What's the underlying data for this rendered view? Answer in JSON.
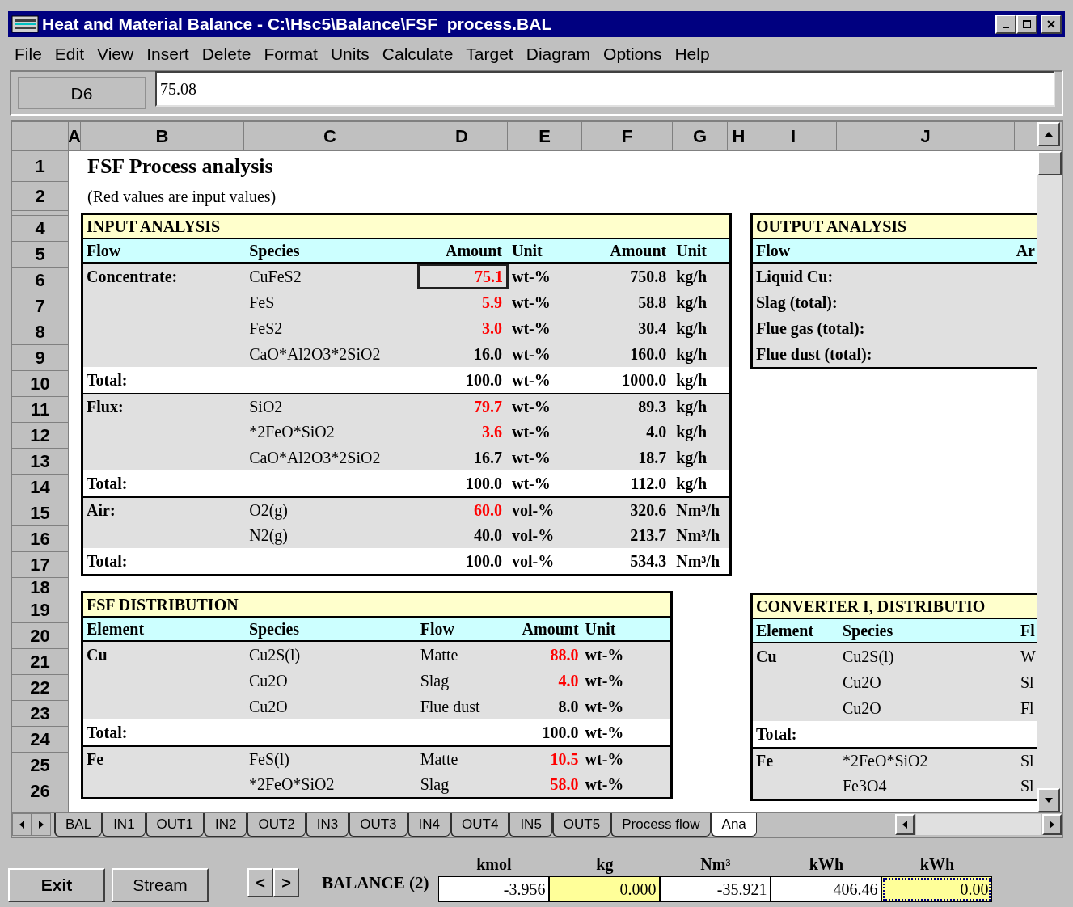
{
  "window": {
    "title": "Heat and Material Balance - C:\\Hsc5\\Balance\\FSF_process.BAL"
  },
  "menu": [
    "File",
    "Edit",
    "View",
    "Insert",
    "Delete",
    "Format",
    "Units",
    "Calculate",
    "Target",
    "Diagram",
    "Options",
    "Help"
  ],
  "formula_bar": {
    "cell": "D6",
    "value": "75.08"
  },
  "columns": [
    "A",
    "B",
    "C",
    "D",
    "E",
    "F",
    "G",
    "H",
    "I",
    "J"
  ],
  "row_numbers": [
    "1",
    "2",
    "4",
    "5",
    "6",
    "7",
    "8",
    "9",
    "10",
    "11",
    "12",
    "13",
    "14",
    "15",
    "16",
    "17",
    "18",
    "19",
    "20",
    "21",
    "22",
    "23",
    "24",
    "25",
    "26"
  ],
  "sheet_title": "FSF Process analysis",
  "sheet_note": "(Red values are input values)",
  "input_analysis": {
    "title": "INPUT ANALYSIS",
    "header": [
      "Flow",
      "Species",
      "Amount",
      "Unit",
      "Amount",
      "Unit"
    ],
    "rows": [
      {
        "flow": "Concentrate:",
        "species": "CuFeS2",
        "amount": "75.1",
        "unit": "wt-%",
        "amount2": "750.8",
        "unit2": "kg/h",
        "input": true,
        "total": false,
        "selected": true
      },
      {
        "species": "FeS",
        "amount": "5.9",
        "unit": "wt-%",
        "amount2": "58.8",
        "unit2": "kg/h",
        "input": true,
        "total": false,
        "selected": false
      },
      {
        "species": "FeS2",
        "amount": "3.0",
        "unit": "wt-%",
        "amount2": "30.4",
        "unit2": "kg/h",
        "input": true,
        "total": false,
        "selected": false
      },
      {
        "species": "CaO*Al2O3*2SiO2",
        "amount": "16.0",
        "unit": "wt-%",
        "amount2": "160.0",
        "unit2": "kg/h",
        "input": false,
        "total": false,
        "selected": false
      },
      {
        "flow": "Total:",
        "amount": "100.0",
        "unit": "wt-%",
        "amount2": "1000.0",
        "unit2": "kg/h",
        "input": false,
        "total": true,
        "selected": false
      },
      {
        "flow": "Flux:",
        "species": "SiO2",
        "amount": "79.7",
        "unit": "wt-%",
        "amount2": "89.3",
        "unit2": "kg/h",
        "input": true,
        "total": false,
        "selected": false
      },
      {
        "species": "*2FeO*SiO2",
        "amount": "3.6",
        "unit": "wt-%",
        "amount2": "4.0",
        "unit2": "kg/h",
        "input": true,
        "total": false,
        "selected": false
      },
      {
        "species": "CaO*Al2O3*2SiO2",
        "amount": "16.7",
        "unit": "wt-%",
        "amount2": "18.7",
        "unit2": "kg/h",
        "input": false,
        "total": false,
        "selected": false
      },
      {
        "flow": "Total:",
        "amount": "100.0",
        "unit": "wt-%",
        "amount2": "112.0",
        "unit2": "kg/h",
        "input": false,
        "total": true,
        "selected": false
      },
      {
        "flow": "Air:",
        "species": "O2(g)",
        "amount": "60.0",
        "unit": "vol-%",
        "amount2": "320.6",
        "unit2": "Nm³/h",
        "input": true,
        "total": false,
        "selected": false
      },
      {
        "species": "N2(g)",
        "amount": "40.0",
        "unit": "vol-%",
        "amount2": "213.7",
        "unit2": "Nm³/h",
        "input": false,
        "total": false,
        "selected": false
      },
      {
        "flow": "Total:",
        "amount": "100.0",
        "unit": "vol-%",
        "amount2": "534.3",
        "unit2": "Nm³/h",
        "input": false,
        "total": true,
        "selected": false
      }
    ]
  },
  "output_analysis": {
    "title": "OUTPUT ANALYSIS",
    "header": [
      "Flow",
      "Ar"
    ],
    "rows": [
      "Liquid Cu:",
      "Slag (total):",
      "Flue gas (total):",
      "Flue dust (total):"
    ]
  },
  "fsf_distribution": {
    "title": "FSF DISTRIBUTION",
    "header": [
      "Element",
      "Species",
      "Flow",
      "Amount",
      "Unit"
    ],
    "rows": [
      {
        "element": "Cu",
        "species": "Cu2S(l)",
        "flow": "Matte",
        "amount": "88.0",
        "unit": "wt-%",
        "input": true,
        "total": false
      },
      {
        "species": "Cu2O",
        "flow": "Slag",
        "amount": "4.0",
        "unit": "wt-%",
        "input": true,
        "total": false
      },
      {
        "species": "Cu2O",
        "flow": "Flue dust",
        "amount": "8.0",
        "unit": "wt-%",
        "input": false,
        "total": false
      },
      {
        "element": "Total:",
        "amount": "100.0",
        "unit": "wt-%",
        "input": false,
        "total": true
      },
      {
        "element": "Fe",
        "species": "FeS(l)",
        "flow": "Matte",
        "amount": "10.5",
        "unit": "wt-%",
        "input": true,
        "total": false
      },
      {
        "species": "*2FeO*SiO2",
        "flow": "Slag",
        "amount": "58.0",
        "unit": "wt-%",
        "input": true,
        "total": false
      }
    ]
  },
  "converter_distribution": {
    "title": "CONVERTER I, DISTRIBUTIO",
    "header": [
      "Element",
      "Species",
      "Fl"
    ],
    "rows": [
      {
        "element": "Cu",
        "species": "Cu2S(l)",
        "flow": "W",
        "total": false
      },
      {
        "species": "Cu2O",
        "flow": "Sl",
        "total": false
      },
      {
        "species": "Cu2O",
        "flow": "Fl",
        "total": false
      },
      {
        "element": "Total:",
        "total": true
      },
      {
        "element": "Fe",
        "species": "*2FeO*SiO2",
        "flow": "Sl",
        "total": false
      },
      {
        "species": "Fe3O4",
        "flow": "Sl",
        "total": false
      }
    ]
  },
  "sheet_tabs": [
    {
      "label": "BAL",
      "selected": false
    },
    {
      "label": "IN1",
      "selected": false
    },
    {
      "label": "OUT1",
      "selected": false
    },
    {
      "label": "IN2",
      "selected": false
    },
    {
      "label": "OUT2",
      "selected": false
    },
    {
      "label": "IN3",
      "selected": false
    },
    {
      "label": "OUT3",
      "selected": false
    },
    {
      "label": "IN4",
      "selected": false
    },
    {
      "label": "OUT4",
      "selected": false
    },
    {
      "label": "IN5",
      "selected": false
    },
    {
      "label": "OUT5",
      "selected": false
    },
    {
      "label": "Process flow",
      "selected": false
    },
    {
      "label": "Ana",
      "selected": true
    }
  ],
  "buttons": [
    {
      "label": "Exit"
    },
    {
      "label": "Stream"
    }
  ],
  "nav": [
    "<",
    ">"
  ],
  "balance": {
    "label": "BALANCE (2)",
    "cells": [
      {
        "unit": "kmol",
        "value": "-3.956",
        "highlight": false,
        "selected": false
      },
      {
        "unit": "kg",
        "value": "0.000",
        "highlight": true,
        "selected": false
      },
      {
        "unit": "Nm³",
        "value": "-35.921",
        "highlight": false,
        "selected": false
      },
      {
        "unit": "kWh",
        "value": "406.46",
        "highlight": false,
        "selected": false
      },
      {
        "unit": "kWh",
        "value": "0.00",
        "highlight": true,
        "selected": true
      }
    ]
  }
}
